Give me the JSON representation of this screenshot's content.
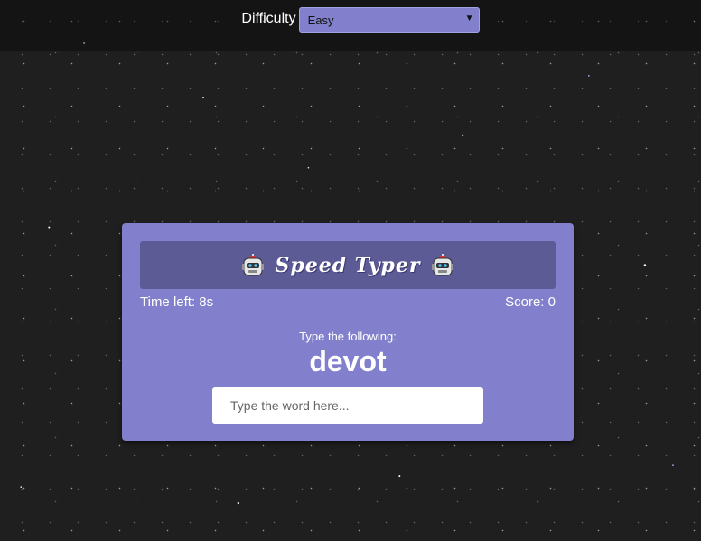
{
  "settings": {
    "difficulty_label": "Difficulty",
    "difficulty_selected": "Easy"
  },
  "game": {
    "title": "Speed Typer",
    "time_label": "Time left: 8s",
    "score_label": "Score: 0",
    "prompt": "Type the following:",
    "current_word": "devot",
    "input_placeholder": "Type the word here...",
    "input_value": ""
  },
  "icons": {
    "robot": "robot-face-icon",
    "dropdown": "chevron-down-icon"
  },
  "colors": {
    "card": "#8280cc",
    "title_bar": "#5d5b96",
    "background": "#1f1f1f"
  }
}
